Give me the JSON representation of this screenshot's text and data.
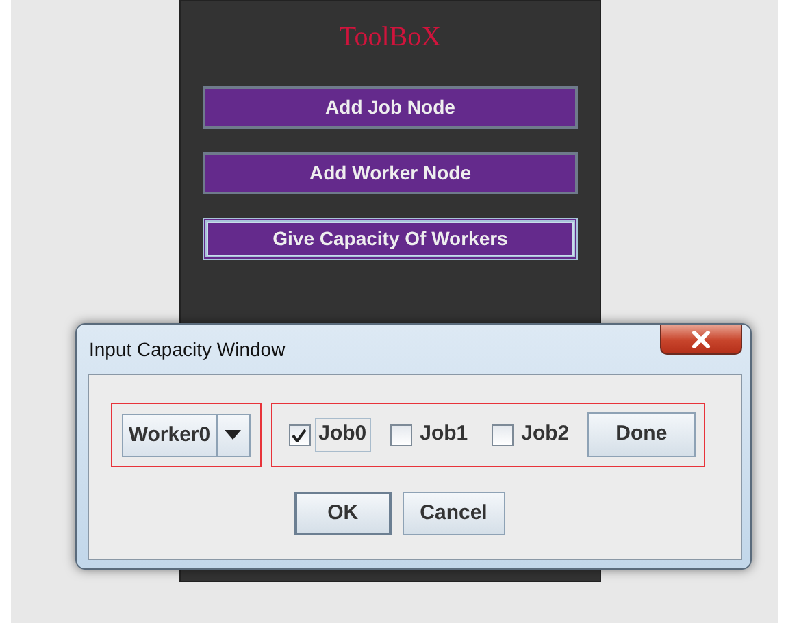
{
  "toolbox": {
    "title": "ToolBoX",
    "buttons": [
      {
        "label": "Add Job Node",
        "focused": false
      },
      {
        "label": "Add Worker Node",
        "focused": false
      },
      {
        "label": "Give Capacity Of Workers",
        "focused": true
      }
    ]
  },
  "dialog": {
    "title": "Input Capacity Window",
    "worker_select": {
      "value": "Worker0"
    },
    "jobs": [
      {
        "label": "Job0",
        "checked": true,
        "focused": true
      },
      {
        "label": "Job1",
        "checked": false,
        "focused": false
      },
      {
        "label": "Job2",
        "checked": false,
        "focused": false
      }
    ],
    "done_button": "Done",
    "buttons": [
      {
        "label": "OK",
        "default": true
      },
      {
        "label": "Cancel",
        "default": false
      }
    ]
  }
}
